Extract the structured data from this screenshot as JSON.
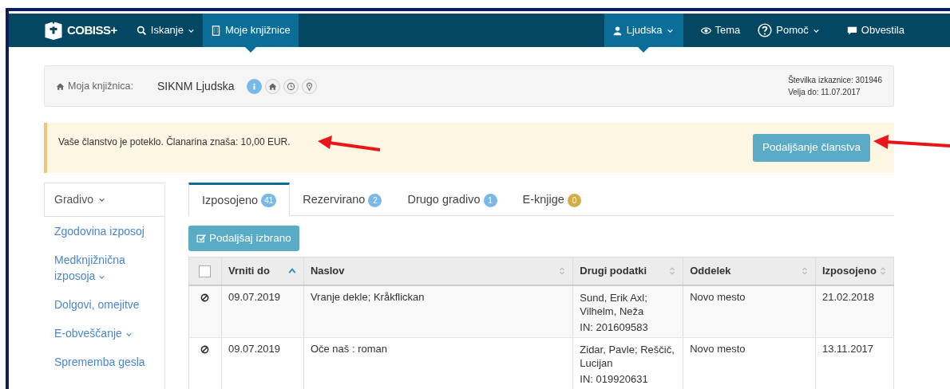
{
  "navbar": {
    "logo": "COBISS+",
    "left_items": [
      {
        "label": "Iskanje",
        "dropdown": true,
        "selected": false
      },
      {
        "label": "Moje knjižnice",
        "dropdown": false,
        "selected": true
      }
    ],
    "right_items": [
      {
        "label": "Ljudska",
        "dropdown": true,
        "selected": true
      },
      {
        "label": "Tema",
        "dropdown": false,
        "selected": false
      },
      {
        "label": "Pomoč",
        "dropdown": true,
        "selected": false
      },
      {
        "label": "Obvestila",
        "dropdown": false,
        "selected": false
      }
    ]
  },
  "library_bar": {
    "label": "Moja knjižnica:",
    "name": "SIKNM Ljudska",
    "icon_buttons": [
      {
        "selected": true
      },
      {
        "selected": false
      },
      {
        "selected": false
      },
      {
        "selected": false
      }
    ],
    "card_number": "Številka izkaznice: 301946",
    "valid_until": "Velja do: 11.07.2017"
  },
  "alert": {
    "message": "Vaše članstvo je poteklo. Članarina znaša: 10,00 EUR.",
    "button": "Podaljšanje članstva"
  },
  "sidebar": {
    "items": [
      {
        "label": "Gradivo",
        "kind": "header",
        "dropdown": true
      },
      {
        "label": "Zgodovina izposoj",
        "kind": "link",
        "dropdown": false
      },
      {
        "label": "Medknjižnična izposoja",
        "kind": "link",
        "dropdown": true
      },
      {
        "label": "Dolgovi, omejitve",
        "kind": "link",
        "dropdown": false
      },
      {
        "label": "E-obveščanje",
        "kind": "link",
        "dropdown": true
      },
      {
        "label": "Sprememba gesla",
        "kind": "link",
        "dropdown": false
      }
    ]
  },
  "tabs": [
    {
      "label": "Izposojeno",
      "count": "41",
      "color": "#7ab8e8",
      "selected": true
    },
    {
      "label": "Rezervirano",
      "count": "2",
      "color": "#7ab8e8",
      "selected": false
    },
    {
      "label": "Drugo gradivo",
      "count": "1",
      "color": "#7ab8e8",
      "selected": false
    },
    {
      "label": "E-knjige",
      "count": "0",
      "color": "#d4ad4a",
      "selected": false
    }
  ],
  "action_button": "Podaljšaj izbrano",
  "table": {
    "select_all_checked": false,
    "columns": [
      {
        "label": "Vrniti do",
        "sorted": true
      },
      {
        "label": "Naslov",
        "sorted": false
      },
      {
        "label": "Drugi podatki",
        "sorted": false
      },
      {
        "label": "Oddelek",
        "sorted": false
      },
      {
        "label": "Izposojeno",
        "sorted": false
      }
    ],
    "rows": [
      {
        "return_date": "09.07.2019",
        "title": "Vranje dekle; Kråkflickan",
        "authors": "Sund, Erik Axl; Vilhelm, Neža",
        "inventory": "IN: 201609583",
        "department": "Novo mesto",
        "borrowed": "21.02.2018"
      },
      {
        "return_date": "09.07.2019",
        "title": "Oče naš : roman",
        "authors": "Zidar, Pavle; Reščič, Lucijan",
        "inventory": "IN: 019920631",
        "department": "Novo mesto",
        "borrowed": "13.11.2017"
      }
    ]
  }
}
